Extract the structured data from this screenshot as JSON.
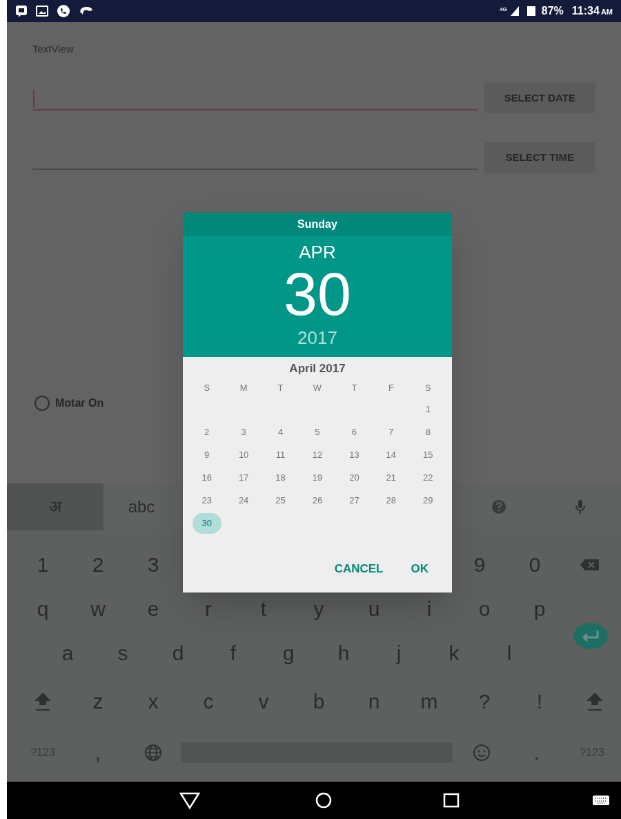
{
  "status_bar": {
    "network": "4G",
    "battery": "87%",
    "time": "11:34",
    "meridiem": "AM"
  },
  "form": {
    "label": "TextView",
    "date_field": {
      "focused": true
    },
    "date_button": "SELECT DATE",
    "time_field": {
      "focused": false
    },
    "time_button": "SELECT TIME",
    "radio": {
      "label": "Motar On",
      "checked": false
    }
  },
  "keyboard": {
    "suggestions": {
      "left": [
        {
          "kind": "text",
          "label": "अ",
          "selected": true
        },
        {
          "kind": "text",
          "label": "abc",
          "selected": false
        }
      ],
      "right": [
        {
          "kind": "help"
        },
        {
          "kind": "mic"
        }
      ]
    },
    "number_row": {
      "left": [
        {
          "kind": "char",
          "label": "1"
        },
        {
          "kind": "char",
          "label": "2"
        },
        {
          "kind": "char",
          "label": "3"
        }
      ],
      "right": [
        {
          "kind": "char",
          "label": "9"
        },
        {
          "kind": "char",
          "label": "0"
        },
        {
          "kind": "backspace"
        }
      ]
    },
    "letter_rows": [
      {
        "keys": [
          {
            "kind": "char",
            "label": "q"
          },
          {
            "kind": "char",
            "label": "w"
          },
          {
            "kind": "char",
            "label": "e"
          },
          {
            "kind": "char",
            "label": "r"
          },
          {
            "kind": "char",
            "label": "t"
          },
          {
            "kind": "char",
            "label": "y"
          },
          {
            "kind": "char",
            "label": "u"
          },
          {
            "kind": "char",
            "label": "i"
          },
          {
            "kind": "char",
            "label": "o"
          },
          {
            "kind": "char",
            "label": "p"
          }
        ]
      },
      {
        "keys": [
          {
            "kind": "char",
            "label": "a"
          },
          {
            "kind": "char",
            "label": "s"
          },
          {
            "kind": "char",
            "label": "d"
          },
          {
            "kind": "char",
            "label": "f"
          },
          {
            "kind": "char",
            "label": "g"
          },
          {
            "kind": "char",
            "label": "h"
          },
          {
            "kind": "char",
            "label": "j"
          },
          {
            "kind": "char",
            "label": "k"
          },
          {
            "kind": "char",
            "label": "l"
          },
          {
            "kind": "enter"
          }
        ]
      },
      {
        "keys": [
          {
            "kind": "shift"
          },
          {
            "kind": "char",
            "label": "z"
          },
          {
            "kind": "char",
            "label": "x"
          },
          {
            "kind": "char",
            "label": "c"
          },
          {
            "kind": "char",
            "label": "v"
          },
          {
            "kind": "char",
            "label": "b"
          },
          {
            "kind": "char",
            "label": "n"
          },
          {
            "kind": "char",
            "label": "m"
          },
          {
            "kind": "char",
            "label": "?"
          },
          {
            "kind": "char",
            "label": "!"
          },
          {
            "kind": "shift"
          }
        ]
      },
      {
        "keys": [
          {
            "kind": "small",
            "label": "?123"
          },
          {
            "kind": "char",
            "label": ","
          },
          {
            "kind": "globe"
          },
          {
            "kind": "space"
          },
          {
            "kind": "emoji"
          },
          {
            "kind": "char",
            "label": "."
          },
          {
            "kind": "small",
            "label": "?123"
          }
        ]
      }
    ]
  },
  "dialog": {
    "weekday": "Sunday",
    "month": "APR",
    "day": "30",
    "year": "2017",
    "month_title": "April 2017",
    "weekdays": [
      "S",
      "M",
      "T",
      "W",
      "T",
      "F",
      "S"
    ],
    "weeks": [
      [
        {
          "label": "1",
          "selected": false
        }
      ],
      [
        {
          "label": "2",
          "selected": false
        },
        {
          "label": "3",
          "selected": false
        },
        {
          "label": "4",
          "selected": false
        },
        {
          "label": "5",
          "selected": false
        },
        {
          "label": "6",
          "selected": false
        },
        {
          "label": "7",
          "selected": false
        },
        {
          "label": "8",
          "selected": false
        }
      ],
      [
        {
          "label": "9",
          "selected": false
        },
        {
          "label": "10",
          "selected": false
        },
        {
          "label": "11",
          "selected": false
        },
        {
          "label": "12",
          "selected": false
        },
        {
          "label": "13",
          "selected": false
        },
        {
          "label": "14",
          "selected": false
        },
        {
          "label": "15",
          "selected": false
        }
      ],
      [
        {
          "label": "16",
          "selected": false
        },
        {
          "label": "17",
          "selected": false
        },
        {
          "label": "18",
          "selected": false
        },
        {
          "label": "19",
          "selected": false
        },
        {
          "label": "20",
          "selected": false
        },
        {
          "label": "21",
          "selected": false
        },
        {
          "label": "22",
          "selected": false
        }
      ],
      [
        {
          "label": "23",
          "selected": false
        },
        {
          "label": "24",
          "selected": false
        },
        {
          "label": "25",
          "selected": false
        },
        {
          "label": "26",
          "selected": false
        },
        {
          "label": "27",
          "selected": false
        },
        {
          "label": "28",
          "selected": false
        },
        {
          "label": "29",
          "selected": false
        }
      ],
      [
        {
          "label": "30",
          "selected": true
        }
      ]
    ],
    "buttons": [
      "CANCEL",
      "OK"
    ]
  }
}
